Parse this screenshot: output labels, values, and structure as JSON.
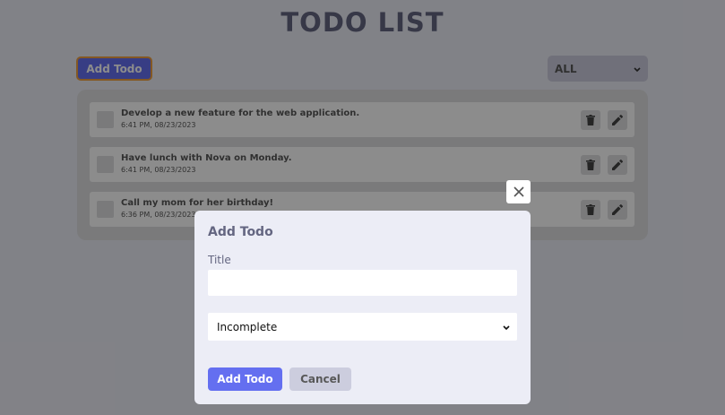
{
  "app": {
    "title": "TODO LIST"
  },
  "header": {
    "add_button_label": "Add Todo",
    "filter_selected": "ALL"
  },
  "todos": [
    {
      "title": "Develop a new feature for the web application.",
      "time": "6:41 PM, 08/23/2023"
    },
    {
      "title": "Have lunch with Nova on Monday.",
      "time": "6:41 PM, 08/23/2023"
    },
    {
      "title": "Call my mom for her birthday!",
      "time": "6:36 PM, 08/23/2023"
    }
  ],
  "modal": {
    "heading": "Add Todo",
    "title_label": "Title",
    "title_value": "",
    "status_selected": "Incomplete",
    "submit_label": "Add Todo",
    "cancel_label": "Cancel"
  },
  "colors": {
    "primary": "#646ff0",
    "background": "#ecedf6",
    "secondary": "#cccdde",
    "title_text": "#646681"
  },
  "icons": {
    "delete": "trash-icon",
    "edit": "pencil-icon",
    "close": "close-icon",
    "dropdown": "chevron-down-icon"
  }
}
